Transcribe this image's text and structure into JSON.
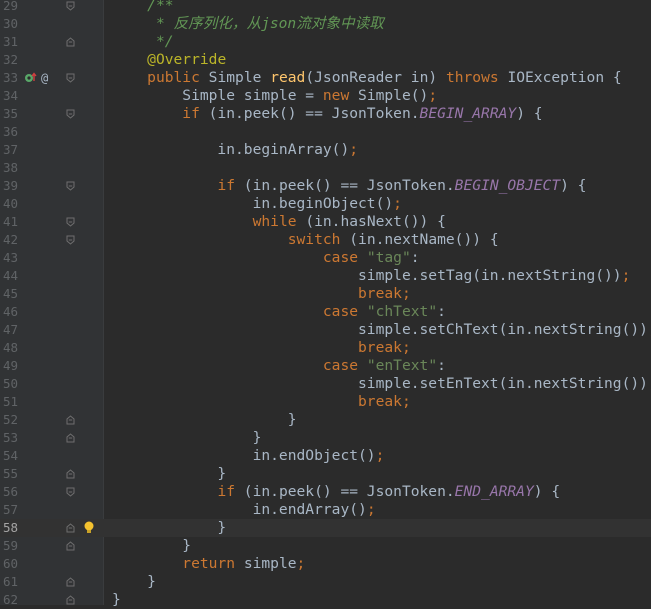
{
  "lines": [
    {
      "num": "29",
      "segments": [
        {
          "t": "    "
        },
        {
          "t": "/**",
          "c": "c"
        }
      ],
      "fold": "open"
    },
    {
      "num": "30",
      "segments": [
        {
          "t": "     "
        },
        {
          "t": "* 反序列化，从",
          "c": "c"
        },
        {
          "t": "json",
          "c": "c"
        },
        {
          "t": "流对象中读取",
          "c": "c"
        }
      ]
    },
    {
      "num": "31",
      "segments": [
        {
          "t": "     "
        },
        {
          "t": "*/",
          "c": "c"
        }
      ],
      "fold": "close"
    },
    {
      "num": "32",
      "segments": [
        {
          "t": "    "
        },
        {
          "t": "@Override",
          "c": "a"
        }
      ]
    },
    {
      "num": "33",
      "segments": [
        {
          "t": "    "
        },
        {
          "t": "public ",
          "c": "k"
        },
        {
          "t": "Simple "
        },
        {
          "t": "read",
          "c": "f"
        },
        {
          "t": "(JsonReader in) "
        },
        {
          "t": "throws ",
          "c": "k"
        },
        {
          "t": "IOException {"
        }
      ],
      "fold": "open",
      "marker": "override",
      "at": "@"
    },
    {
      "num": "34",
      "segments": [
        {
          "t": "        Simple simple = "
        },
        {
          "t": "new ",
          "c": "k"
        },
        {
          "t": "Simple()"
        },
        {
          "t": ";",
          "c": "k"
        }
      ]
    },
    {
      "num": "35",
      "segments": [
        {
          "t": "        "
        },
        {
          "t": "if ",
          "c": "k"
        },
        {
          "t": "(in.peek() == JsonToken."
        },
        {
          "t": "BEGIN_ARRAY",
          "c": "i"
        },
        {
          "t": ") {"
        }
      ],
      "fold": "open"
    },
    {
      "num": "36",
      "segments": []
    },
    {
      "num": "37",
      "segments": [
        {
          "t": "            in.beginArray()"
        },
        {
          "t": ";",
          "c": "k"
        }
      ]
    },
    {
      "num": "38",
      "segments": []
    },
    {
      "num": "39",
      "segments": [
        {
          "t": "            "
        },
        {
          "t": "if ",
          "c": "k"
        },
        {
          "t": "(in.peek() == JsonToken."
        },
        {
          "t": "BEGIN_OBJECT",
          "c": "i"
        },
        {
          "t": ") {"
        }
      ],
      "fold": "open"
    },
    {
      "num": "40",
      "segments": [
        {
          "t": "                in.beginObject()"
        },
        {
          "t": ";",
          "c": "k"
        }
      ]
    },
    {
      "num": "41",
      "segments": [
        {
          "t": "                "
        },
        {
          "t": "while ",
          "c": "k"
        },
        {
          "t": "(in.hasNext()) {"
        }
      ],
      "fold": "open"
    },
    {
      "num": "42",
      "segments": [
        {
          "t": "                    "
        },
        {
          "t": "switch ",
          "c": "k"
        },
        {
          "t": "(in.nextName()) {"
        }
      ],
      "fold": "open"
    },
    {
      "num": "43",
      "segments": [
        {
          "t": "                        "
        },
        {
          "t": "case ",
          "c": "k"
        },
        {
          "t": "\"tag\"",
          "c": "s"
        },
        {
          "t": ":"
        }
      ]
    },
    {
      "num": "44",
      "segments": [
        {
          "t": "                            simple.setTag(in.nextString())"
        },
        {
          "t": ";",
          "c": "k"
        }
      ]
    },
    {
      "num": "45",
      "segments": [
        {
          "t": "                            "
        },
        {
          "t": "break;",
          "c": "k"
        }
      ]
    },
    {
      "num": "46",
      "segments": [
        {
          "t": "                        "
        },
        {
          "t": "case ",
          "c": "k"
        },
        {
          "t": "\"chText\"",
          "c": "s"
        },
        {
          "t": ":"
        }
      ]
    },
    {
      "num": "47",
      "segments": [
        {
          "t": "                            simple.setChText(in.nextString())"
        },
        {
          "t": ";",
          "c": "k"
        }
      ]
    },
    {
      "num": "48",
      "segments": [
        {
          "t": "                            "
        },
        {
          "t": "break;",
          "c": "k"
        }
      ]
    },
    {
      "num": "49",
      "segments": [
        {
          "t": "                        "
        },
        {
          "t": "case ",
          "c": "k"
        },
        {
          "t": "\"enText\"",
          "c": "s"
        },
        {
          "t": ":"
        }
      ]
    },
    {
      "num": "50",
      "segments": [
        {
          "t": "                            simple.setEnText(in.nextString())"
        },
        {
          "t": ";",
          "c": "k"
        }
      ]
    },
    {
      "num": "51",
      "segments": [
        {
          "t": "                            "
        },
        {
          "t": "break;",
          "c": "k"
        }
      ]
    },
    {
      "num": "52",
      "segments": [
        {
          "t": "                    }"
        }
      ],
      "fold": "close"
    },
    {
      "num": "53",
      "segments": [
        {
          "t": "                }"
        }
      ],
      "fold": "close"
    },
    {
      "num": "54",
      "segments": [
        {
          "t": "                in.endObject()"
        },
        {
          "t": ";",
          "c": "k"
        }
      ]
    },
    {
      "num": "55",
      "segments": [
        {
          "t": "            }"
        }
      ],
      "fold": "close"
    },
    {
      "num": "56",
      "segments": [
        {
          "t": "            "
        },
        {
          "t": "if ",
          "c": "k"
        },
        {
          "t": "(in.peek() == JsonToken."
        },
        {
          "t": "END_ARRAY",
          "c": "i"
        },
        {
          "t": ") {"
        }
      ],
      "fold": "open"
    },
    {
      "num": "57",
      "segments": [
        {
          "t": "                in.endArray()"
        },
        {
          "t": ";",
          "c": "k"
        }
      ]
    },
    {
      "num": "58",
      "segments": [
        {
          "t": "            }"
        }
      ],
      "fold": "close",
      "current": true,
      "marker": "bulb"
    },
    {
      "num": "59",
      "segments": [
        {
          "t": "        }"
        }
      ],
      "fold": "close"
    },
    {
      "num": "60",
      "segments": [
        {
          "t": "        "
        },
        {
          "t": "return ",
          "c": "k"
        },
        {
          "t": "simple"
        },
        {
          "t": ";",
          "c": "k"
        }
      ]
    },
    {
      "num": "61",
      "segments": [
        {
          "t": "    }"
        }
      ],
      "fold": "close"
    },
    {
      "num": "62",
      "segments": [
        {
          "t": "}"
        }
      ],
      "fold": "close"
    }
  ],
  "icons": {
    "override": "override-gutter-icon",
    "bulb": "lightbulb-icon",
    "fold_open": "fold-open-icon",
    "fold_close": "fold-close-icon"
  },
  "colors": {
    "background": "#2b2b2b",
    "gutter": "#313335",
    "keyword": "#cc7832",
    "string": "#6a8759",
    "comment": "#629755",
    "annotation": "#bbb529",
    "method": "#ffc66d",
    "constant": "#9876aa",
    "default": "#a9b7c6",
    "bulb": "#f4c22f",
    "override": "#59a869"
  }
}
